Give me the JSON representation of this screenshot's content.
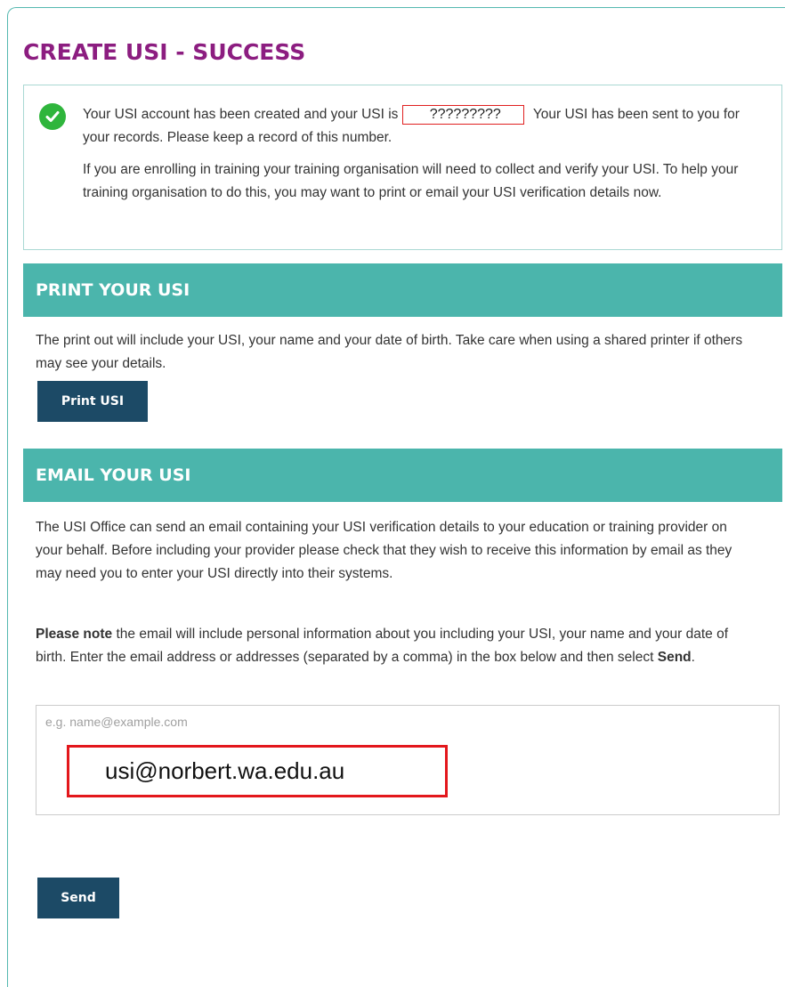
{
  "page": {
    "title": "CREATE USI - SUCCESS"
  },
  "success": {
    "icon": "check-circle-icon",
    "icon_color": "#2fb53c",
    "text_before_usi": "Your USI account has been created and your USI is",
    "usi_value": "?????????",
    "text_after_usi": "Your USI has been sent to you for your records. Please keep a record of this number.",
    "paragraph2": "If you are enrolling in training your training organisation will need to collect and verify your USI. To help your training organisation to do this, you may want to print or email your USI verification details now."
  },
  "print_section": {
    "heading": "PRINT YOUR USI",
    "description": "The print out will include your USI, your name and your date of birth. Take care when using a shared printer if others may see your details.",
    "button_label": "Print USI"
  },
  "email_section": {
    "heading": "EMAIL YOUR USI",
    "description": "The USI Office can send an email containing your USI verification details to your education or training provider on your behalf. Before including your provider please check that they wish to receive this information by email as they may need you to enter your USI directly into their systems.",
    "note_bold": "Please note",
    "note_text": "the email will include personal information about you including your USI, your name and your date of birth. Enter the email address or addresses (separated by a comma) in the box below and then select",
    "note_send_bold": "Send",
    "note_end": ".",
    "input_placeholder": "e.g. name@example.com",
    "input_value": "usi@norbert.wa.edu.au",
    "button_label": "Send"
  },
  "colors": {
    "title": "#8c1d80",
    "section_header": "#4bb5ac",
    "button": "#1c4a66",
    "highlight_box": "#e3171c"
  }
}
